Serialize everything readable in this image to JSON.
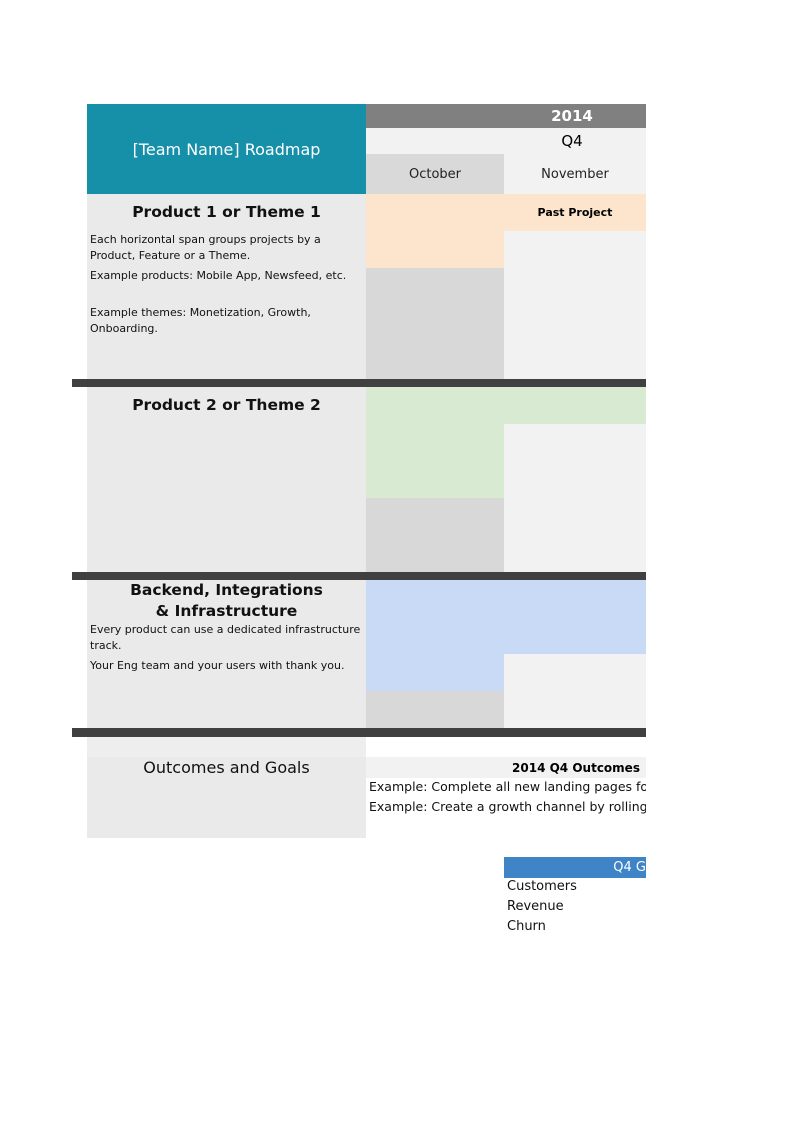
{
  "header": {
    "title": "[Team Name] Roadmap",
    "year": "2014",
    "quarter": "Q4",
    "months": [
      "October",
      "November"
    ]
  },
  "sections": [
    {
      "title": "Product 1 or Theme 1",
      "description": [
        "Each horizontal span groups projects by a Product, Feature or a Theme.",
        "Example products: Mobile App, Newsfeed, etc.",
        "Example themes: Monetization, Growth, Onboarding."
      ],
      "project_label": "Past Project",
      "color": "#FCE4CD"
    },
    {
      "title": "Product 2 or Theme 2",
      "description": [],
      "color": "#D9EAD3"
    },
    {
      "title": "Backend, Integrations & Infrastructure",
      "description": [
        "Every product can use a dedicated infrastructure track.",
        "Your Eng team and your users with thank you."
      ],
      "color": "#C9DAF6"
    }
  ],
  "outcomes": {
    "title": "Outcomes and Goals",
    "heading": "2014 Q4 Outcomes",
    "items": [
      "Example: Complete all new landing pages for",
      "Example: Create a growth channel by rolling c"
    ]
  },
  "goals": {
    "heading": "Q4 G",
    "items": [
      "Customers",
      "Revenue",
      "Churn"
    ],
    "color": "#3E84C6"
  },
  "colors": {
    "title_bg": "#168FA8",
    "year_bg": "#808080",
    "divider": "#404040"
  }
}
